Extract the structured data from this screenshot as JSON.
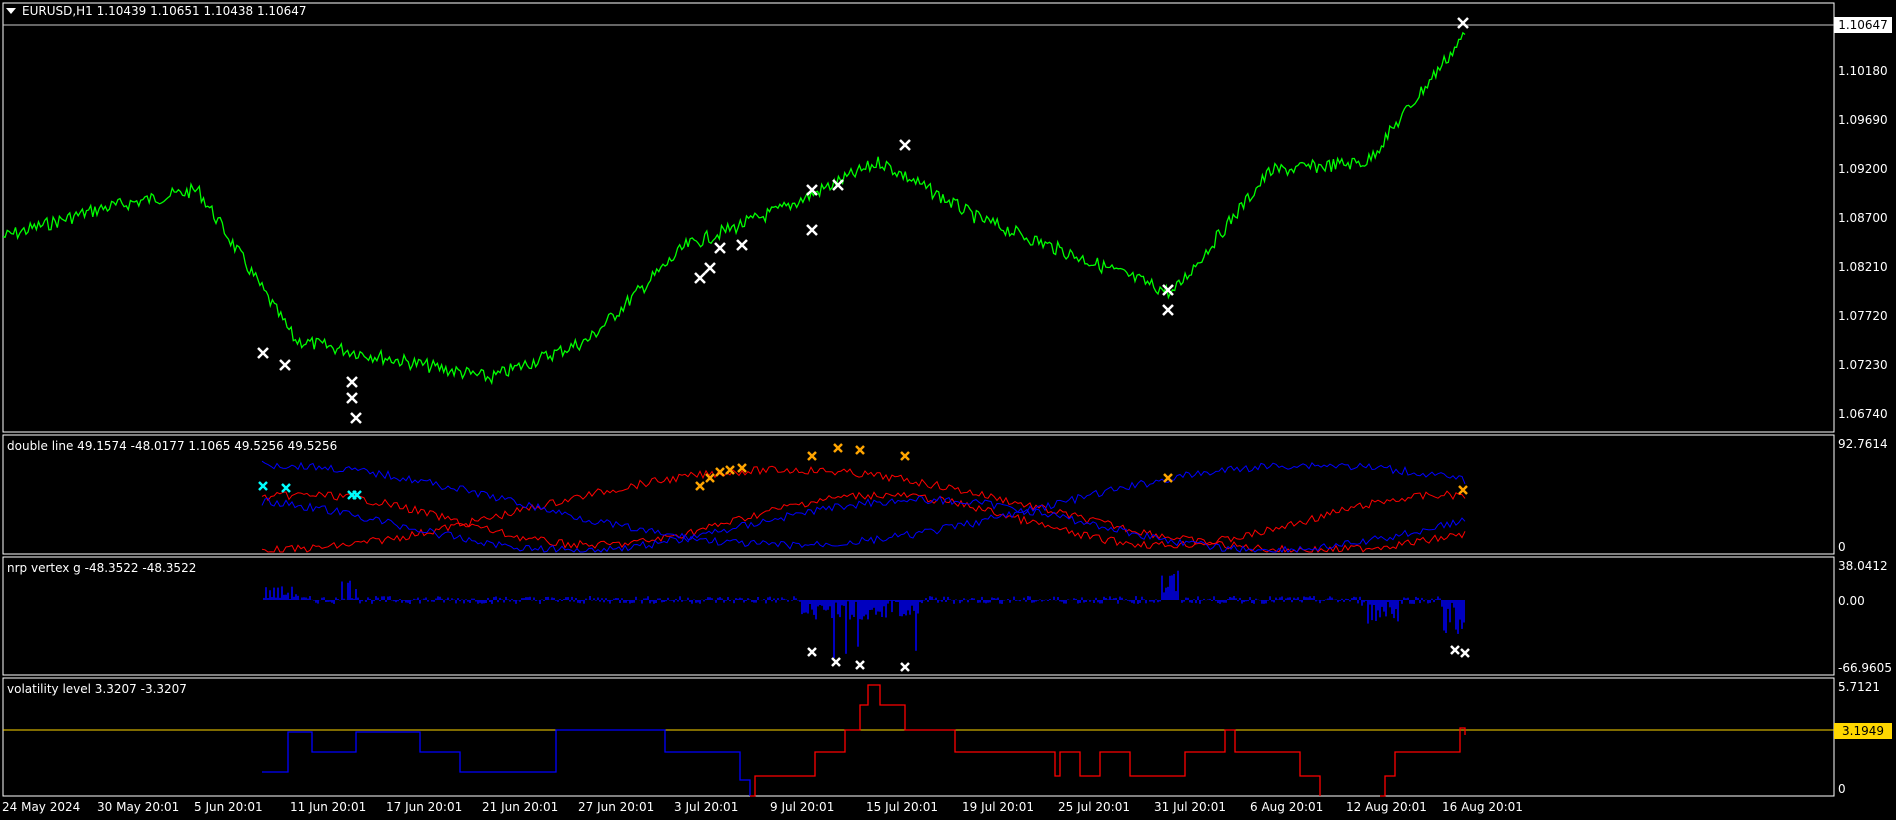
{
  "main": {
    "title": "EURUSD,H1  1.10439 1.10651 1.10438 1.10647",
    "price_levels": [
      "1.10180",
      "1.09690",
      "1.09200",
      "1.08700",
      "1.08210",
      "1.07720",
      "1.07230",
      "1.06740"
    ],
    "current_price": "1.10647"
  },
  "panels": [
    {
      "title": "double line 49.1574 -48.0177 1.1065 49.5256 49.5256",
      "scale_top": "92.7614",
      "scale_bottom": "0"
    },
    {
      "title": "nrp vertex g -48.3522 -48.3522",
      "scale_top": "38.0412",
      "scale_mid": "0.00",
      "scale_bottom": "-66.9605"
    },
    {
      "title": "volatility level 3.3207 -3.3207",
      "scale_top": "5.7121",
      "level": "3.1949",
      "scale_bottom": "0"
    }
  ],
  "dates": [
    "24 May 2024",
    "30 May 20:01",
    "5 Jun 20:01",
    "11 Jun 20:01",
    "17 Jun 20:01",
    "21 Jun 20:01",
    "27 Jun 20:01",
    "3 Jul 20:01",
    "9 Jul 20:01",
    "15 Jul 20:01",
    "19 Jul 20:01",
    "25 Jul 20:01",
    "31 Jul 20:01",
    "6 Aug 20:01",
    "12 Aug 20:01",
    "16 Aug 20:01"
  ],
  "colors": {
    "price_line": "#00ff00",
    "grid_border": "#ffffff",
    "red": "#ff0000",
    "blue": "#0000ff",
    "orange": "#ffa500",
    "cyan": "#00ffff",
    "level": "#ffd700",
    "background": "#000000"
  },
  "chart_data": {
    "type": "line",
    "title": "EURUSD,H1",
    "ylim": [
      1.065,
      1.107
    ],
    "x": [
      "24 May 2024",
      "30 May 20:01",
      "5 Jun 20:01",
      "11 Jun 20:01",
      "17 Jun 20:01",
      "21 Jun 20:01",
      "27 Jun 20:01",
      "3 Jul 20:01",
      "9 Jul 20:01",
      "15 Jul 20:01",
      "19 Jul 20:01",
      "25 Jul 20:01",
      "31 Jul 20:01",
      "6 Aug 20:01",
      "12 Aug 20:01",
      "16 Aug 20:01"
    ],
    "series": [
      {
        "values": [
          1.085,
          1.088,
          1.09,
          1.074,
          1.072,
          1.07,
          1.074,
          1.084,
          1.088,
          1.093,
          1.087,
          1.083,
          1.079,
          1.092,
          1.093,
          1.1065
        ]
      }
    ]
  }
}
